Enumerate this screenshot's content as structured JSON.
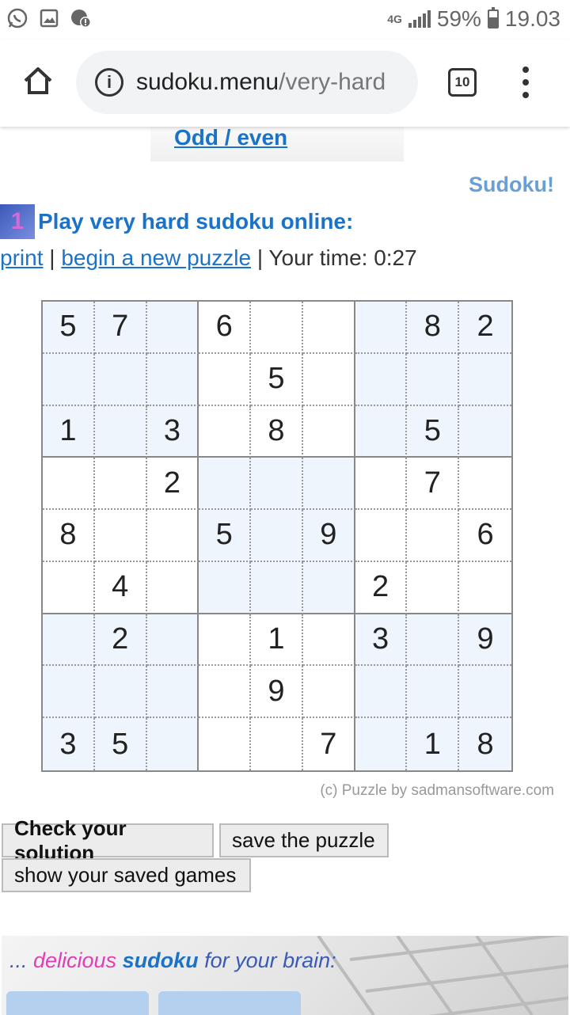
{
  "status_bar": {
    "network": "4G",
    "battery": "59%",
    "time": "19.03",
    "left_icons": [
      "whatsapp-icon",
      "image-icon",
      "alert-icon"
    ]
  },
  "browser": {
    "url_domain": "sudoku.menu",
    "url_path": "/very-hard",
    "tab_count": "10"
  },
  "page": {
    "odd_even_link": "Odd / even",
    "sudoku_link": "Sudoku!",
    "heading_icon_glyph": "1",
    "heading": "Play very hard sudoku online:",
    "print_link": "print",
    "separator": "|",
    "new_puzzle_link": "begin a new puzzle",
    "your_time": "Your time: 0:27",
    "credit": "(c) Puzzle by sadmansoftware.com",
    "check_button": "Check your solution",
    "save_button": "save the puzzle",
    "show_saved_button": "show your saved games",
    "promo": {
      "prefix": "... ",
      "word1": "delicious",
      "word2": "sudoku",
      "suffix": " for your brain:"
    }
  },
  "grid": [
    [
      "5",
      "7",
      "",
      "6",
      "",
      "",
      "",
      "8",
      "2"
    ],
    [
      "",
      "",
      "",
      "",
      "5",
      "",
      "",
      "",
      ""
    ],
    [
      "1",
      "",
      "3",
      "",
      "8",
      "",
      "",
      "5",
      ""
    ],
    [
      "",
      "",
      "2",
      "",
      "",
      "",
      "",
      "7",
      ""
    ],
    [
      "8",
      "",
      "",
      "5",
      "",
      "9",
      "",
      "",
      "6"
    ],
    [
      "",
      "4",
      "",
      "",
      "",
      "",
      "2",
      "",
      ""
    ],
    [
      "",
      "2",
      "",
      "",
      "1",
      "",
      "3",
      "",
      "9"
    ],
    [
      "",
      "",
      "",
      "",
      "9",
      "",
      "",
      "",
      ""
    ],
    [
      "3",
      "5",
      "",
      "",
      "",
      "7",
      "",
      "1",
      "8"
    ]
  ]
}
